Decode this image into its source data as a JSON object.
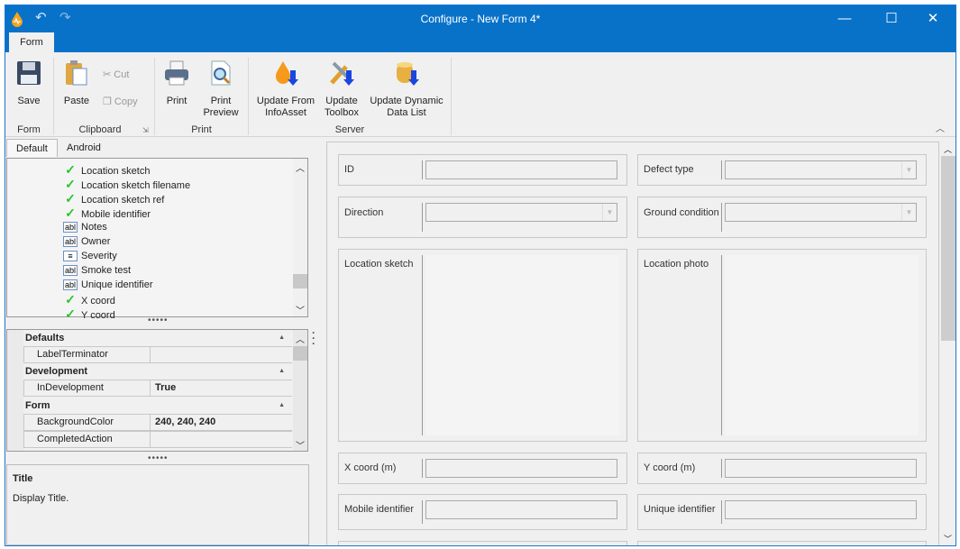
{
  "window": {
    "title": "Configure - New Form 4*",
    "minimize": "—",
    "maximize": "☐",
    "close": "✕"
  },
  "quick_access": {
    "undo": "undo-icon",
    "redo": "redo-icon"
  },
  "ribbon": {
    "tab": "Form",
    "collapse": "︿",
    "buttons": {
      "save": "Save",
      "paste": "Paste",
      "cut": "Cut",
      "copy": "Copy",
      "print": "Print",
      "print_preview_1": "Print",
      "print_preview_2": "Preview",
      "update_infoasset_1": "Update From",
      "update_infoasset_2": "InfoAsset",
      "update_toolbox_1": "Update",
      "update_toolbox_2": "Toolbox",
      "update_ddl_1": "Update Dynamic",
      "update_ddl_2": "Data List"
    },
    "groups": {
      "form": "Form",
      "clipboard": "Clipboard",
      "print": "Print",
      "server": "Server"
    }
  },
  "left_tabs": [
    "Default",
    "Android"
  ],
  "field_list": [
    {
      "label": "Location sketch",
      "icon": "check"
    },
    {
      "label": "Location sketch filename",
      "icon": "check"
    },
    {
      "label": "Location sketch ref",
      "icon": "check"
    },
    {
      "label": "Mobile identifier",
      "icon": "check"
    },
    {
      "label": "Notes",
      "icon": "abl"
    },
    {
      "label": "Owner",
      "icon": "abl"
    },
    {
      "label": "Severity",
      "icon": "list"
    },
    {
      "label": "Smoke test",
      "icon": "abl"
    },
    {
      "label": "Unique identifier",
      "icon": "abl"
    },
    {
      "label": "X coord",
      "icon": "check"
    },
    {
      "label": "Y coord",
      "icon": "check"
    }
  ],
  "properties": {
    "cat_defaults": "Defaults",
    "label_terminator": "LabelTerminator",
    "cat_development": "Development",
    "in_development": "InDevelopment",
    "in_development_value": "True",
    "cat_form": "Form",
    "background_color": "BackgroundColor",
    "background_color_value": "240, 240, 240",
    "completed_action": "CompletedAction"
  },
  "description": {
    "title": "Title",
    "text": "Display Title."
  },
  "designer": {
    "fields": {
      "id": "ID",
      "defect_type": "Defect type",
      "direction": "Direction",
      "ground_condition": "Ground condition",
      "location_sketch": "Location sketch",
      "location_photo": "Location photo",
      "x_coord": "X coord (m)",
      "y_coord": "Y coord (m)",
      "mobile_identifier": "Mobile identifier",
      "unique_identifier": "Unique identifier"
    }
  },
  "colors": {
    "titlebar": "#0872c9",
    "check": "#2bc42b"
  }
}
